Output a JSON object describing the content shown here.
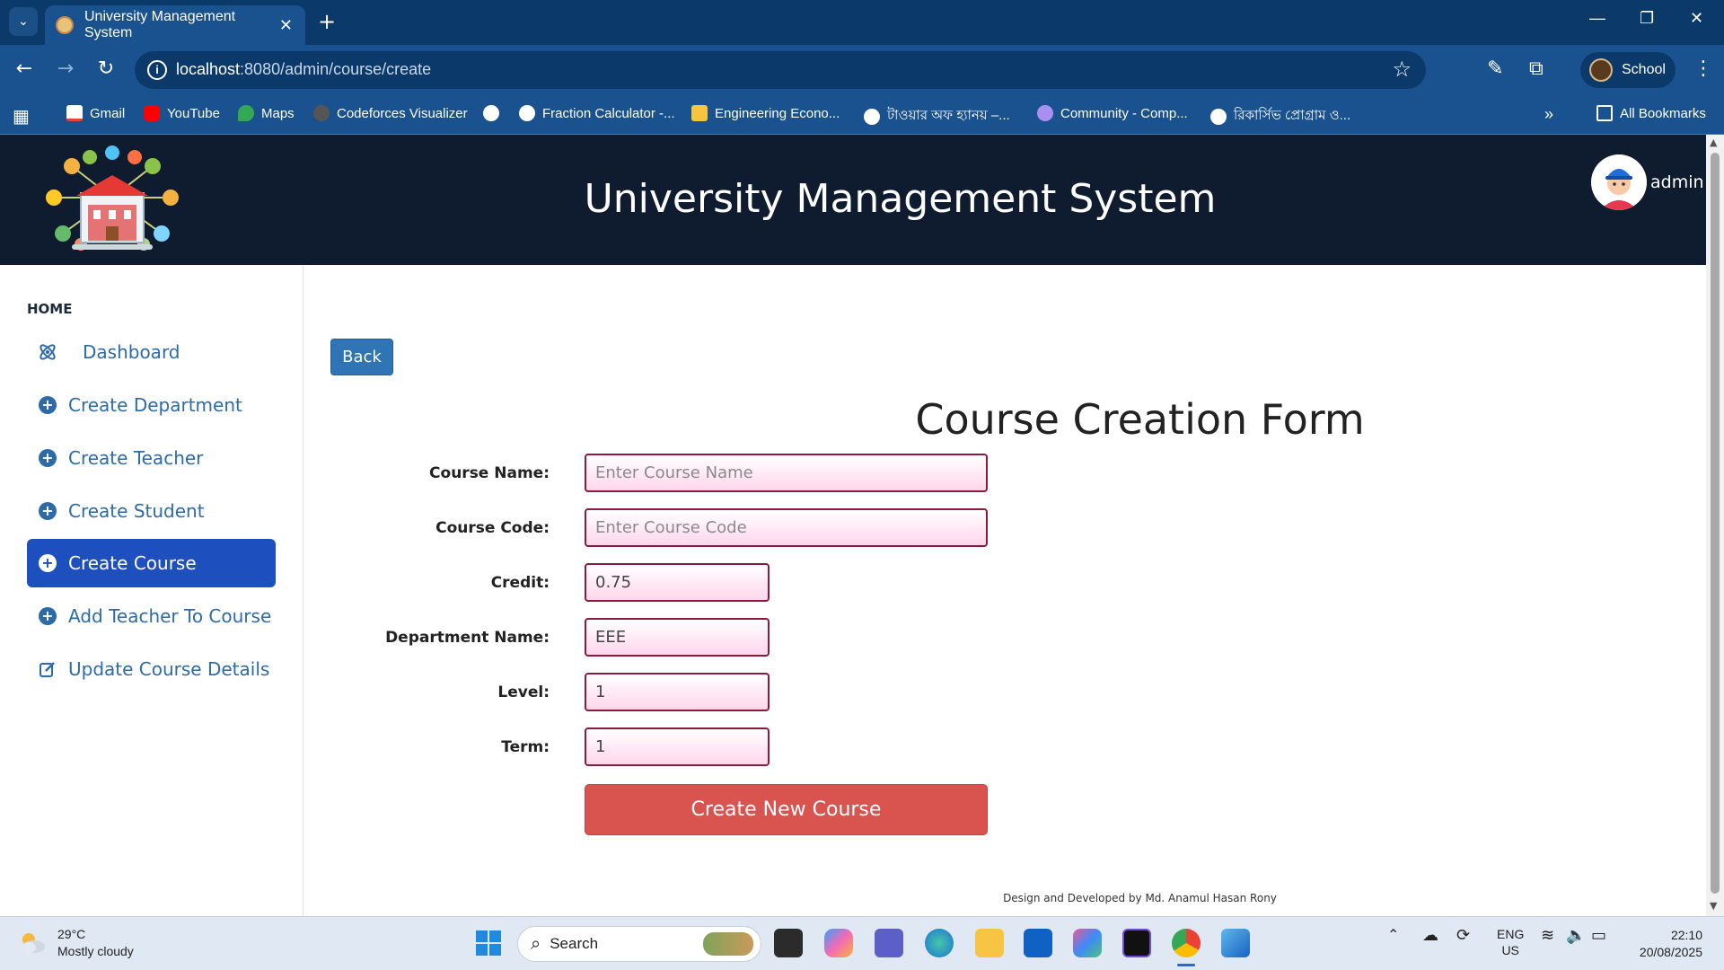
{
  "browser": {
    "tab_title": "University Management System",
    "url_host": "localhost",
    "url_path": ":8080/admin/course/create",
    "profile_name": "School",
    "bookmarks": [
      {
        "label": "Gmail"
      },
      {
        "label": "YouTube"
      },
      {
        "label": "Maps"
      },
      {
        "label": "Codeforces Visualizer"
      },
      {
        "label": ""
      },
      {
        "label": "Fraction Calculator -..."
      },
      {
        "label": "Engineering Econo..."
      },
      {
        "label": "টাওয়ার অফ হ্যানয় –..."
      },
      {
        "label": "Community - Comp..."
      },
      {
        "label": "রিকার্সিভ প্রোগ্রাম ও..."
      }
    ],
    "all_bookmarks": "All Bookmarks"
  },
  "header": {
    "title": "University Management System",
    "user": "admin"
  },
  "sidebar": {
    "heading": "HOME",
    "items": [
      {
        "label": "Dashboard",
        "icon": "atom-icon",
        "active": false
      },
      {
        "label": "Create Department",
        "icon": "plus-circle-icon",
        "active": false
      },
      {
        "label": "Create Teacher",
        "icon": "plus-circle-icon",
        "active": false
      },
      {
        "label": "Create Student",
        "icon": "plus-circle-icon",
        "active": false
      },
      {
        "label": "Create Course",
        "icon": "plus-circle-icon",
        "active": true
      },
      {
        "label": "Add Teacher To Course",
        "icon": "plus-circle-icon",
        "active": false
      },
      {
        "label": "Update Course Details",
        "icon": "edit-icon",
        "active": false
      }
    ]
  },
  "form": {
    "back_label": "Back",
    "title": "Course Creation Form",
    "course_name_label": "Course Name:",
    "course_name_placeholder": "Enter Course Name",
    "course_code_label": "Course Code:",
    "course_code_placeholder": "Enter Course Code",
    "credit_label": "Credit:",
    "credit_value": "0.75",
    "department_label": "Department Name:",
    "department_value": "EEE",
    "level_label": "Level:",
    "level_value": "1",
    "term_label": "Term:",
    "term_value": "1",
    "submit_label": "Create New Course"
  },
  "footer": {
    "credit": "Design and Developed by Md. Anamul Hasan Rony"
  },
  "taskbar": {
    "temperature": "29°C",
    "weather": "Mostly cloudy",
    "search_label": "Search",
    "lang_top": "ENG",
    "lang_bottom": "US",
    "time": "22:10",
    "date": "20/08/2025"
  },
  "colors": {
    "header_bg": "#0f1b2f",
    "sidebar_active": "#1e4fbf",
    "link_blue": "#2c6aa8",
    "back_button": "#2f74b5",
    "submit_button": "#d9534f",
    "input_border": "#8a1b3a",
    "input_fill": "#ffd6ec"
  }
}
